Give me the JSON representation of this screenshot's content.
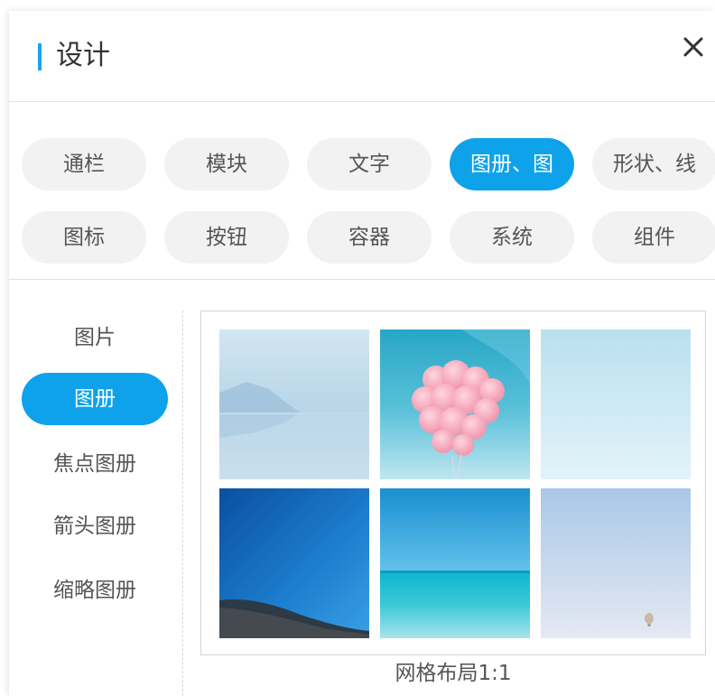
{
  "header": {
    "title": "设计",
    "close_icon": "close-icon",
    "accent_color": "#1aa3e6"
  },
  "categories": {
    "row1": [
      "通栏",
      "模块",
      "文字",
      "图册、图",
      "形状、线"
    ],
    "row2": [
      "图标",
      "按钮",
      "容器",
      "系统",
      "组件"
    ],
    "active": "图册、图",
    "active_color": "#0ea2ea"
  },
  "subnav": {
    "items": [
      "图片",
      "图册",
      "焦点图册",
      "箭头图册",
      "缩略图册"
    ],
    "active": "图册"
  },
  "template": {
    "caption": "网格布局1:1",
    "thumbnails": [
      "misty-lake-reflection",
      "pink-balloons-sky",
      "pale-blue-sky",
      "deep-blue-sky-hill",
      "turquoise-sea-horizon",
      "hazy-sky-hot-air-balloon"
    ]
  }
}
